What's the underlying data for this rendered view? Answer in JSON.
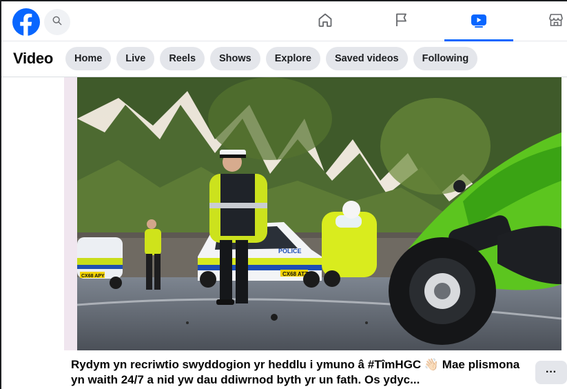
{
  "topnav": {
    "logo_icon": "facebook-logo-icon",
    "search_icon": "search-icon",
    "tabs": [
      {
        "icon": "home-icon",
        "active": false
      },
      {
        "icon": "flag-icon",
        "active": false
      },
      {
        "icon": "video-icon",
        "active": true
      },
      {
        "icon": "marketplace-icon",
        "active": false
      }
    ],
    "accent_color": "#0866ff"
  },
  "subnav": {
    "title": "Video",
    "chips": [
      "Home",
      "Live",
      "Reels",
      "Shows",
      "Explore",
      "Saved videos",
      "Following"
    ]
  },
  "video": {
    "plate_left": "CX68 APY",
    "plate_center": "CX68 ATZ",
    "car_label": "POLICE",
    "mute_icon": "speaker-muted-icon"
  },
  "post": {
    "caption": "Rydym yn recriwtio swyddogion yr heddlu i ymuno â #TîmHGC 👋🏻 Mae plismona yn waith 24/7 a nid yw dau ddiwrnod byth yr un fath. Os ydyc...",
    "more_label": "···"
  }
}
